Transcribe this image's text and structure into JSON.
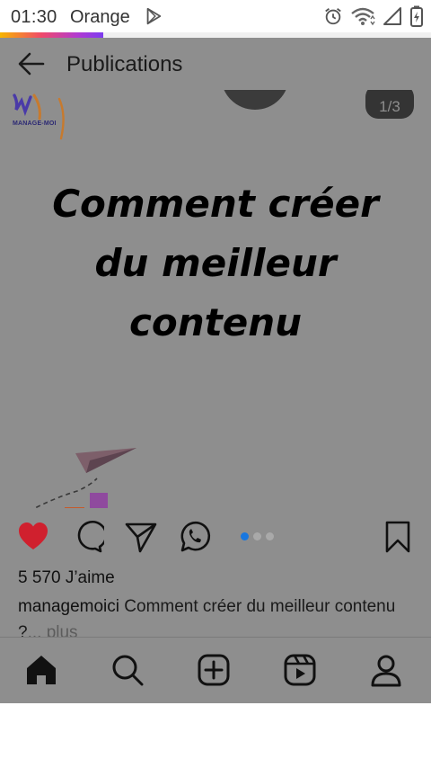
{
  "status_bar": {
    "time": "01:30",
    "carrier": "Orange",
    "left_icons": [
      "play-store-icon"
    ],
    "right_icons": [
      "alarm-icon",
      "wifi-icon",
      "signal-icon",
      "battery-icon"
    ],
    "progress_fraction": 0.24
  },
  "header": {
    "title": "Publications",
    "back_icon": "arrow-left-icon"
  },
  "post": {
    "page_counter": "1/3",
    "headline_lines": [
      "Comment créer",
      "du meilleur",
      "contenu"
    ],
    "brand_logo_text": "MANAGE-MOI",
    "chart_colors": [
      "#b8922c",
      "#4a2b4a",
      "#c65a2a",
      "#8f4a9e"
    ]
  },
  "actions": {
    "like_icon": "heart-filled-icon",
    "comment_icon": "comment-icon",
    "share_icon": "send-icon",
    "whatsapp_icon": "whatsapp-icon",
    "save_icon": "bookmark-icon",
    "carousel_dots": 3,
    "carousel_active": 0,
    "like_color": "#d0202e"
  },
  "likes_text": "5 570 J’aime",
  "caption": {
    "username": "managemoici",
    "text": " Comment créer du meilleur contenu ?",
    "more": "... plus"
  },
  "bottom_nav": {
    "items": [
      "home-icon",
      "search-icon",
      "create-icon",
      "reels-icon",
      "profile-icon"
    ]
  }
}
